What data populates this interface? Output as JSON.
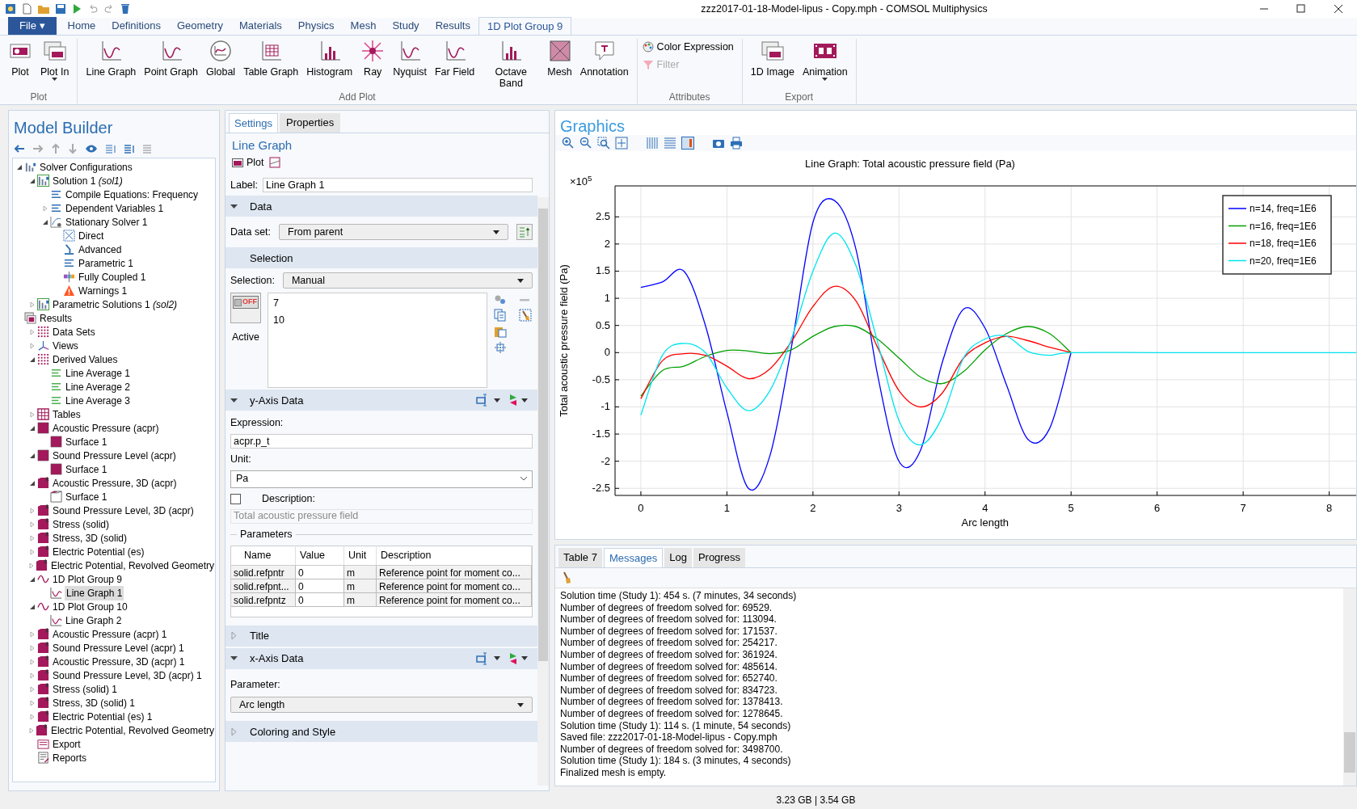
{
  "window": {
    "title": "zzz2017-01-18-Model-lipus - Copy.mph - COMSOL Multiphysics"
  },
  "ribbon_tabs": [
    {
      "label": "File ▾",
      "kind": "menu",
      "selected": false
    },
    {
      "label": "Home",
      "kind": "tab",
      "selected": false
    },
    {
      "label": "Definitions",
      "kind": "tab",
      "selected": false
    },
    {
      "label": "Geometry",
      "kind": "tab",
      "selected": false
    },
    {
      "label": "Materials",
      "kind": "tab",
      "selected": false
    },
    {
      "label": "Physics",
      "kind": "tab",
      "selected": false
    },
    {
      "label": "Mesh",
      "kind": "tab",
      "selected": false
    },
    {
      "label": "Study",
      "kind": "tab",
      "selected": false
    },
    {
      "label": "Results",
      "kind": "tab",
      "selected": false
    },
    {
      "label": "1D Plot Group 9",
      "kind": "tab",
      "selected": true
    }
  ],
  "ribbon_groups": [
    {
      "title": "Plot",
      "buttons": [
        {
          "label": "Plot",
          "kind": "plot",
          "dropdown": false
        },
        {
          "label": "Plot In",
          "kind": "window",
          "dropdown": true
        }
      ]
    },
    {
      "title": "Add Plot",
      "buttons": [
        {
          "label": "Line Graph",
          "kind": "graph",
          "dropdown": false
        },
        {
          "label": "Point Graph",
          "kind": "graph",
          "dropdown": false
        },
        {
          "label": "Global",
          "kind": "globe",
          "dropdown": false
        },
        {
          "label": "Table Graph",
          "kind": "table",
          "dropdown": false
        },
        {
          "label": "Histogram",
          "kind": "bars",
          "dropdown": false
        },
        {
          "label": "Ray",
          "kind": "ray",
          "dropdown": false
        },
        {
          "label": "Nyquist",
          "kind": "graph",
          "dropdown": false
        },
        {
          "label": "Far Field",
          "kind": "graph",
          "dropdown": false
        },
        {
          "label": "Octave Band",
          "kind": "bars",
          "dropdown": false
        },
        {
          "label": "Mesh",
          "kind": "mesh",
          "dropdown": false
        },
        {
          "label": "Annotation",
          "kind": "note",
          "dropdown": false
        }
      ]
    },
    {
      "title": "Attributes",
      "small_buttons": [
        {
          "label": "Color Expression",
          "disabled": false
        },
        {
          "label": "Filter",
          "disabled": true
        }
      ]
    },
    {
      "title": "Export",
      "buttons": [
        {
          "label": "1D Image",
          "kind": "window",
          "dropdown": false
        },
        {
          "label": "Animation",
          "kind": "film",
          "dropdown": true
        }
      ]
    }
  ],
  "model_builder": {
    "title": "Model Builder",
    "tree": [
      {
        "label": "Solver Configurations",
        "kind": "solver",
        "expanded": true,
        "selected": false,
        "children": [
          {
            "label": "Solution 1 *(sol1)*",
            "kind": "solution",
            "expanded": true,
            "selected": false,
            "children": [
              {
                "label": "Compile Equations: Frequency",
                "kind": "equations",
                "selected": false
              },
              {
                "label": "Dependent Variables 1",
                "kind": "variables",
                "expanded": false,
                "selected": false
              },
              {
                "label": "Stationary Solver 1",
                "kind": "stationary",
                "expanded": true,
                "selected": false,
                "children": [
                  {
                    "label": "Direct",
                    "kind": "direct",
                    "selected": false
                  },
                  {
                    "label": "Advanced",
                    "kind": "advanced",
                    "selected": false
                  },
                  {
                    "label": "Parametric 1",
                    "kind": "parametric",
                    "selected": false
                  },
                  {
                    "label": "Fully Coupled 1",
                    "kind": "coupled",
                    "selected": false
                  },
                  {
                    "label": "Warnings 1",
                    "kind": "warning",
                    "selected": false
                  }
                ]
              }
            ]
          },
          {
            "label": "Parametric Solutions 1 *(sol2)*",
            "kind": "solution",
            "expanded": false,
            "selected": false
          }
        ]
      },
      {
        "label": "Results",
        "kind": "results",
        "selected": false,
        "children": [
          {
            "label": "Data Sets",
            "kind": "datasets",
            "expanded": false,
            "selected": false
          },
          {
            "label": "Views",
            "kind": "views",
            "expanded": false,
            "selected": false
          },
          {
            "label": "Derived Values",
            "kind": "derived",
            "expanded": true,
            "selected": false,
            "children": [
              {
                "label": "Line Average 1",
                "kind": "average",
                "selected": false
              },
              {
                "label": "Line Average 2",
                "kind": "average",
                "selected": false
              },
              {
                "label": "Line Average 3",
                "kind": "average",
                "selected": false
              }
            ]
          },
          {
            "label": "Tables",
            "kind": "tables",
            "expanded": false,
            "selected": false
          },
          {
            "label": "Acoustic Pressure (acpr)",
            "kind": "plot2d",
            "expanded": true,
            "selected": false,
            "children": [
              {
                "label": "Surface 1",
                "kind": "plot2d",
                "selected": false
              }
            ]
          },
          {
            "label": "Sound Pressure Level (acpr)",
            "kind": "plot2d",
            "expanded": true,
            "selected": false,
            "children": [
              {
                "label": "Surface 1",
                "kind": "plot2d",
                "selected": false
              }
            ]
          },
          {
            "label": "Acoustic Pressure, 3D (acpr)",
            "kind": "plot3d",
            "expanded": true,
            "selected": false,
            "children": [
              {
                "label": "Surface 1",
                "kind": "surface3d",
                "selected": false
              }
            ]
          },
          {
            "label": "Sound Pressure Level, 3D (acpr)",
            "kind": "plot3d",
            "expanded": false,
            "selected": false
          },
          {
            "label": "Stress (solid)",
            "kind": "plot3d",
            "expanded": false,
            "selected": false
          },
          {
            "label": "Stress, 3D (solid)",
            "kind": "plot3d",
            "expanded": false,
            "selected": false
          },
          {
            "label": "Electric Potential (es)",
            "kind": "plot3d",
            "expanded": false,
            "selected": false
          },
          {
            "label": "Electric Potential, Revolved Geometry",
            "kind": "plot3d",
            "expanded": false,
            "selected": false
          },
          {
            "label": "1D Plot Group 9",
            "kind": "plotgroup1d",
            "expanded": true,
            "selected": false,
            "children": [
              {
                "label": "Line Graph 1",
                "kind": "linegraph",
                "selected": true
              }
            ]
          },
          {
            "label": "1D Plot Group 10",
            "kind": "plotgroup1d",
            "expanded": true,
            "selected": false,
            "children": [
              {
                "label": "Line Graph 2",
                "kind": "linegraph",
                "selected": false
              }
            ]
          },
          {
            "label": "Acoustic Pressure (acpr) 1",
            "kind": "plot3d",
            "expanded": false,
            "selected": false
          },
          {
            "label": "Sound Pressure Level (acpr) 1",
            "kind": "plot3d",
            "expanded": false,
            "selected": false
          },
          {
            "label": "Acoustic Pressure, 3D (acpr) 1",
            "kind": "plot3d",
            "expanded": false,
            "selected": false
          },
          {
            "label": "Sound Pressure Level, 3D (acpr) 1",
            "kind": "plot3d",
            "expanded": false,
            "selected": false
          },
          {
            "label": "Stress (solid) 1",
            "kind": "plot3d",
            "expanded": false,
            "selected": false
          },
          {
            "label": "Stress, 3D (solid) 1",
            "kind": "plot3d",
            "expanded": false,
            "selected": false
          },
          {
            "label": "Electric Potential (es) 1",
            "kind": "plot3d",
            "expanded": false,
            "selected": false
          },
          {
            "label": "Electric Potential, Revolved Geometry",
            "kind": "plot3d",
            "expanded": false,
            "selected": false
          },
          {
            "label": "Export",
            "kind": "export",
            "selected": false
          },
          {
            "label": "Reports",
            "kind": "reports",
            "selected": false
          }
        ]
      }
    ]
  },
  "settings": {
    "tabs": [
      {
        "label": "Settings",
        "selected": true
      },
      {
        "label": "Properties",
        "selected": false
      }
    ],
    "title": "Line Graph",
    "plot_button": "Plot",
    "label_field": {
      "label": "Label:",
      "value": "Line Graph 1"
    },
    "data_section": {
      "title": "Data",
      "expanded": true,
      "dataset_label": "Data set:",
      "dataset_value": "From parent"
    },
    "selection_section": {
      "title": "Selection",
      "selection_label": "Selection:",
      "selection_value": "Manual",
      "toggle_text": "OFF",
      "on": false,
      "active_label": "Active",
      "entities": [
        "7",
        "10"
      ]
    },
    "y_axis_section": {
      "title": "y-Axis Data",
      "expanded": true,
      "expression_label": "Expression:",
      "expression": "acpr.p_t",
      "unit_label": "Unit:",
      "unit": "Pa",
      "description_label": "Description:",
      "description_checked": false,
      "description": "Total acoustic pressure field",
      "parameters_title": "Parameters",
      "columns": [
        "Name",
        "Value",
        "Unit",
        "Description"
      ],
      "rows": [
        [
          "solid.refpntr",
          "0",
          "m",
          "Reference point for moment co..."
        ],
        [
          "solid.refpnt...",
          "0",
          "m",
          "Reference point for moment co..."
        ],
        [
          "solid.refpntz",
          "0",
          "m",
          "Reference point for moment co..."
        ]
      ]
    },
    "title_section": {
      "title": "Title",
      "expanded": false
    },
    "x_axis_section": {
      "title": "x-Axis Data",
      "expanded": true,
      "parameter_label": "Parameter:",
      "parameter": "Arc length"
    },
    "coloring_section": {
      "title": "Coloring and Style",
      "expanded": false
    }
  },
  "graphics": {
    "title": "Graphics",
    "y_multiplier": "×10$^{5}$",
    "chart_data": {
      "type": "line",
      "title": "Line Graph: Total acoustic pressure field (Pa)",
      "xlabel": "Arc length",
      "ylabel": "Total acoustic pressure field (Pa)",
      "x": [
        0,
        0.25,
        0.5,
        0.75,
        1,
        1.25,
        1.5,
        1.75,
        2,
        2.25,
        2.5,
        2.75,
        3,
        3.25,
        3.5,
        3.75,
        4,
        4.25,
        4.5,
        4.75,
        5,
        6,
        7,
        8,
        8.35
      ],
      "series": [
        {
          "name": "n=14, freq=1E6",
          "color": "#0000ff",
          "values": [
            1.2,
            1.3,
            1.5,
            0.5,
            -1.1,
            -2.5,
            -1.9,
            0.1,
            2.4,
            2.8,
            1.9,
            -0.4,
            -2.0,
            -1.8,
            -0.2,
            0.8,
            0.45,
            -0.6,
            -1.6,
            -1.4,
            0,
            null,
            null,
            null,
            null
          ]
        },
        {
          "name": "n=16, freq=1E6",
          "color": "#00a000",
          "values": [
            -0.8,
            -0.33,
            -0.25,
            -0.07,
            0.04,
            0.03,
            -0.02,
            0.05,
            0.3,
            0.48,
            0.48,
            0.25,
            -0.1,
            -0.45,
            -0.57,
            -0.35,
            0.05,
            0.35,
            0.48,
            0.35,
            0,
            null,
            null,
            null,
            null
          ]
        },
        {
          "name": "n=18, freq=1E6",
          "color": "#ff0000",
          "values": [
            -0.85,
            -0.15,
            -0.02,
            -0.05,
            -0.25,
            -0.48,
            -0.3,
            0.2,
            0.85,
            1.22,
            0.95,
            0.1,
            -0.7,
            -1.0,
            -0.75,
            -0.1,
            0.18,
            0.3,
            0.22,
            0.1,
            0,
            null,
            null,
            null,
            null
          ]
        },
        {
          "name": "n=20, freq=1E6",
          "color": "#00e5ee",
          "values": [
            -1.15,
            -0.05,
            0.17,
            0,
            -0.65,
            -1.07,
            -0.7,
            0.25,
            1.5,
            2.2,
            1.6,
            0.2,
            -1.25,
            -1.7,
            -1.2,
            -0.1,
            0.25,
            0.3,
            0.02,
            -0.05,
            0,
            0,
            0,
            0,
            0
          ]
        }
      ],
      "grid": true,
      "legend": true,
      "xlim": [
        -0.3,
        8.37
      ],
      "ylim": [
        -2.63,
        3.07
      ],
      "xticks": [
        {
          "value": 0,
          "label": "0"
        },
        {
          "value": 1,
          "label": "1"
        },
        {
          "value": 2,
          "label": "2"
        },
        {
          "value": 3,
          "label": "3"
        },
        {
          "value": 4,
          "label": "4"
        },
        {
          "value": 5,
          "label": "5"
        },
        {
          "value": 6,
          "label": "6"
        },
        {
          "value": 7,
          "label": "7"
        },
        {
          "value": 8,
          "label": "8"
        }
      ],
      "yticks": [
        {
          "value": -2.5,
          "label": "-2.5"
        },
        {
          "value": -2,
          "label": "-2"
        },
        {
          "value": -1.5,
          "label": "-1.5"
        },
        {
          "value": -1,
          "label": "-1"
        },
        {
          "value": -0.5,
          "label": "-0.5"
        },
        {
          "value": 0,
          "label": "0"
        },
        {
          "value": 0.5,
          "label": "0.5"
        },
        {
          "value": 1,
          "label": "1"
        },
        {
          "value": 1.5,
          "label": "1.5"
        },
        {
          "value": 2,
          "label": "2"
        },
        {
          "value": 2.5,
          "label": "2.5"
        }
      ]
    }
  },
  "messages": {
    "tabs": [
      {
        "label": "Table 7",
        "selected": false
      },
      {
        "label": "Messages",
        "selected": true
      },
      {
        "label": "Log",
        "selected": false
      },
      {
        "label": "Progress",
        "selected": false
      }
    ],
    "lines": [
      "Solution time (Study 1): 454 s. (7 minutes, 34 seconds)",
      "Number of degrees of freedom solved for: 69529.",
      "Number of degrees of freedom solved for: 113094.",
      "Number of degrees of freedom solved for: 171537.",
      "Number of degrees of freedom solved for: 254217.",
      "Number of degrees of freedom solved for: 361924.",
      "Number of degrees of freedom solved for: 485614.",
      "Number of degrees of freedom solved for: 652740.",
      "Number of degrees of freedom solved for: 834723.",
      "Number of degrees of freedom solved for: 1378413.",
      "Number of degrees of freedom solved for: 1278645.",
      "Solution time (Study 1): 114 s. (1 minute, 54 seconds)",
      "Saved file: zzz2017-01-18-Model-lipus - Copy.mph",
      "Number of degrees of freedom solved for: 3498700.",
      "Solution time (Study 1): 184 s. (3 minutes, 4 seconds)",
      "Finalized mesh is empty."
    ]
  },
  "status_bar": {
    "memory": "3.23 GB | 3.54 GB"
  }
}
